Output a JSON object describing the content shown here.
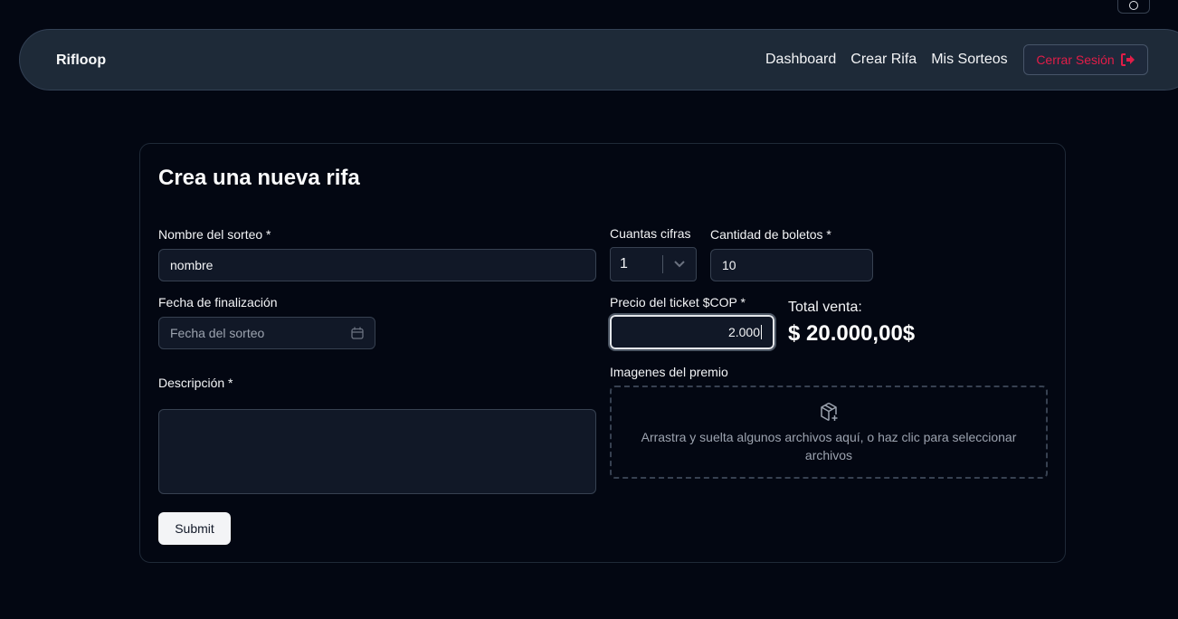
{
  "nav": {
    "brand": "Rifloop",
    "links": [
      "Dashboard",
      "Crear Rifa",
      "Mis Sorteos"
    ],
    "logout_label": "Cerrar Sesión"
  },
  "form": {
    "title": "Crea una nueva rifa",
    "name": {
      "label": "Nombre del sorteo *",
      "value": "nombre"
    },
    "digits": {
      "label": "Cuantas cifras",
      "value": "1"
    },
    "tickets": {
      "label": "Cantidad de boletos *",
      "value": "10"
    },
    "end_date": {
      "label": "Fecha de finalización",
      "placeholder": "Fecha del sorteo"
    },
    "price": {
      "label": "Precio del ticket $COP *",
      "value": "2.000"
    },
    "total": {
      "label": "Total venta:",
      "value": "$ 20.000,00$"
    },
    "images": {
      "label": "Imagenes del premio",
      "dropzone_text": "Arrastra y suelta algunos archivos aquí, o haz clic para seleccionar archivos"
    },
    "description": {
      "label": "Descripción *",
      "value": ""
    },
    "submit_label": "Submit"
  },
  "colors": {
    "background": "#030712",
    "navbar": "#1e2a38",
    "logout": "#e11d48",
    "button": "#f3f4f6"
  },
  "icons": [
    "theme-toggle-icon",
    "logout-icon",
    "calendar-icon",
    "chevron-down-icon",
    "package-plus-icon"
  ]
}
